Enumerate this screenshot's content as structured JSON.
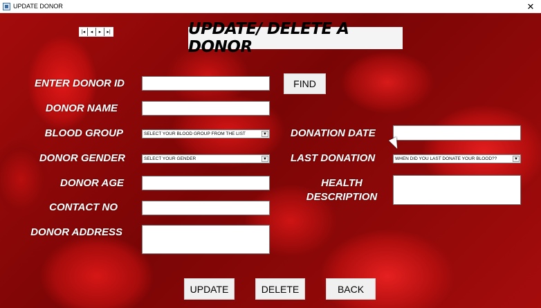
{
  "window": {
    "title": "UPDATE DONOR",
    "close_glyph": "✕"
  },
  "nav": {
    "first": "|◂",
    "prev": "◂",
    "next": "▸",
    "last": "▸|"
  },
  "heading": "UPDATE/ DELETE A DONOR",
  "labels": {
    "donor_id": "ENTER DONOR ID",
    "donor_name": "DONOR NAME",
    "blood_group": "BLOOD GROUP",
    "donor_gender": "DONOR GENDER",
    "donor_age": "DONOR AGE",
    "contact_no": "CONTACT NO",
    "donor_address": "DONOR ADDRESS",
    "donation_date": "DONATION DATE",
    "last_donation": "LAST DONATION",
    "health_description": "HEALTH DESCRIPTION"
  },
  "fields": {
    "donor_id": "",
    "donor_name": "",
    "donor_age": "",
    "contact_no": "",
    "donor_address": "",
    "donation_date": "",
    "health_description": ""
  },
  "selects": {
    "blood_group": "SELECT YOUR BLOOD GROUP FROM THE LIST",
    "donor_gender": "SELECT YOUR GENDER",
    "last_donation": "WHEN DID YOU LAST DONATE YOUR BLOOD??"
  },
  "buttons": {
    "find": "FIND",
    "update": "UPDATE",
    "delete": "DELETE",
    "back": "BACK"
  },
  "icons": {
    "app": "window-app-icon",
    "close": "close-icon",
    "dropdown": "chevron-down-icon"
  },
  "colors": {
    "background_red": "#a40b0b",
    "label_text": "#ffffff",
    "title_bg": "#f4f4f4"
  }
}
